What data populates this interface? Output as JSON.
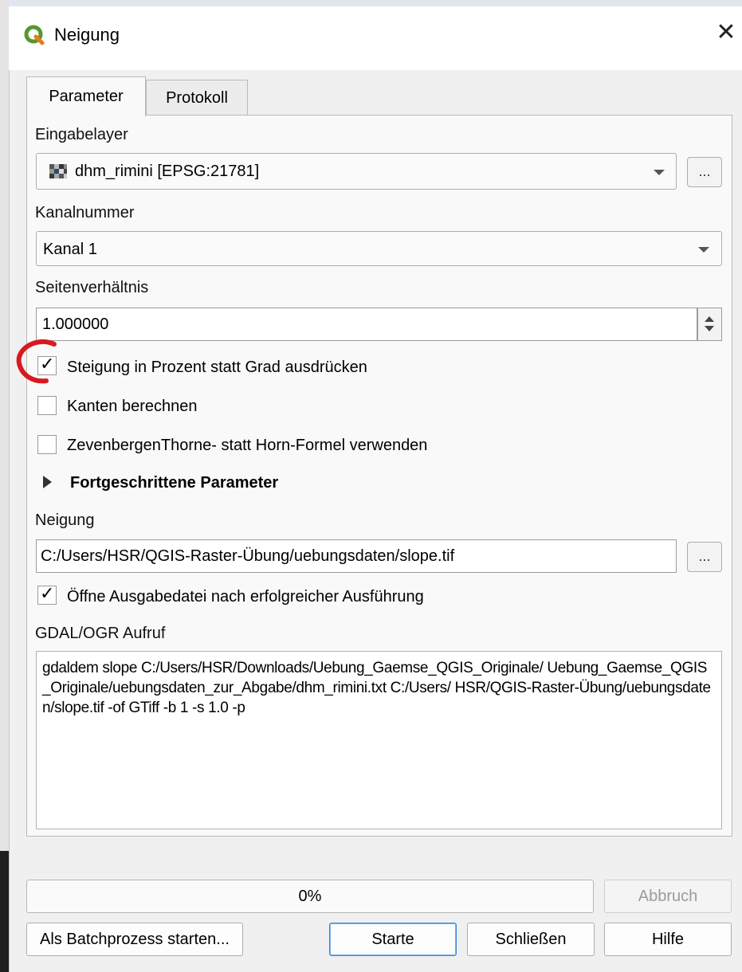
{
  "window": {
    "title": "Neigung",
    "close_symbol": "✕",
    "app_icon": "qgis-logo-icon"
  },
  "tabs": [
    {
      "label": "Parameter",
      "active": true
    },
    {
      "label": "Protokoll",
      "active": false
    }
  ],
  "params": {
    "input_layer_label": "Eingabelayer",
    "input_layer_value": "dhm_rimini [EPSG:21781]",
    "input_layer_icon": "raster-layer-icon",
    "band_label": "Kanalnummer",
    "band_value": "Kanal 1",
    "ratio_label": "Seitenverhältnis",
    "ratio_value": "1.000000",
    "percent_label": "Steigung in Prozent statt Grad ausdrücken",
    "percent_checked": true,
    "edges_label": "Kanten berechnen",
    "edges_checked": false,
    "zevenbergen_label": "ZevenbergenThorne- statt Horn-Formel verwenden",
    "zevenbergen_checked": false,
    "advanced_label": "Fortgeschrittene Parameter",
    "output_label": "Neigung",
    "output_value": "C:/Users/HSR/QGIS-Raster-Übung/uebungsdaten/slope.tif",
    "open_output_label": "Öffne Ausgabedatei nach erfolgreicher Ausführung",
    "open_output_checked": true,
    "gdal_label": "GDAL/OGR Aufruf",
    "gdal_command": "gdaldem slope C:/Users/HSR/Downloads/Uebung_Gaemse_QGIS_Originale/ Uebung_Gaemse_QGIS_Originale/uebungsdaten_zur_Abgabe/dhm_rimini.txt C:/Users/ HSR/QGIS-Raster-Übung/uebungsdaten/slope.tif -of GTiff -b 1 -s 1.0 -p",
    "browse_label": "..."
  },
  "progress": {
    "percent": 0,
    "text": "0%"
  },
  "buttons": {
    "abort": "Abbruch",
    "batch": "Als Batchprozess starten...",
    "run": "Starte",
    "close": "Schließen",
    "help": "Hilfe"
  },
  "colors": {
    "annotation_circle": "#d71920",
    "default_button_border": "#3b86d7",
    "qgis_green": "#589632",
    "qgis_yellow": "#ee7913"
  }
}
